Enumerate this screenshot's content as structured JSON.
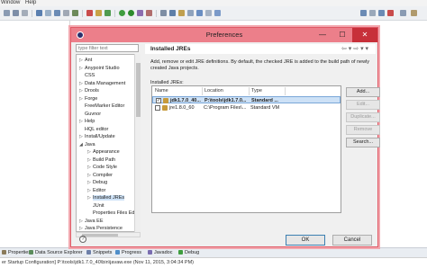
{
  "ide": {
    "menu": [
      "Window",
      "Help"
    ],
    "bottom_tabs": [
      "Properties",
      "Data Source Explorer",
      "Snippets",
      "Progress",
      "Javadoc",
      "Debug"
    ],
    "status_text": "er Startup Configuration] P:\\tools\\jdk1.7.0_40\\bin\\javaw.exe (Nov 11, 2015, 3:04:34 PM)"
  },
  "dialog": {
    "title": "Preferences",
    "window_controls": {
      "minimize": "—",
      "maximize": "☐",
      "close": "✕"
    },
    "filter_placeholder": "type filter text",
    "tree": [
      {
        "label": "Ant",
        "level": 0,
        "expandable": true
      },
      {
        "label": "Anypoint Studio",
        "level": 0,
        "expandable": true
      },
      {
        "label": "CSS",
        "level": 0,
        "expandable": false
      },
      {
        "label": "Data Management",
        "level": 0,
        "expandable": true
      },
      {
        "label": "Drools",
        "level": 0,
        "expandable": true
      },
      {
        "label": "Forge",
        "level": 0,
        "expandable": true
      },
      {
        "label": "FreeMarker Editor",
        "level": 0,
        "expandable": false
      },
      {
        "label": "Guvnor",
        "level": 0,
        "expandable": false
      },
      {
        "label": "Help",
        "level": 0,
        "expandable": true
      },
      {
        "label": "HQL editor",
        "level": 0,
        "expandable": false
      },
      {
        "label": "Install/Update",
        "level": 0,
        "expandable": true
      },
      {
        "label": "Java",
        "level": 0,
        "expandable": true,
        "expanded": true
      },
      {
        "label": "Appearance",
        "level": 1,
        "expandable": true
      },
      {
        "label": "Build Path",
        "level": 1,
        "expandable": true
      },
      {
        "label": "Code Style",
        "level": 1,
        "expandable": true
      },
      {
        "label": "Compiler",
        "level": 1,
        "expandable": true
      },
      {
        "label": "Debug",
        "level": 1,
        "expandable": true
      },
      {
        "label": "Editor",
        "level": 1,
        "expandable": true
      },
      {
        "label": "Installed JREs",
        "level": 1,
        "expandable": true,
        "selected": true
      },
      {
        "label": "JUnit",
        "level": 1,
        "expandable": false
      },
      {
        "label": "Properties Files Editor",
        "level": 1,
        "expandable": false
      },
      {
        "label": "Java EE",
        "level": 0,
        "expandable": true
      },
      {
        "label": "Java Persistence",
        "level": 0,
        "expandable": true
      }
    ],
    "pane": {
      "title": "Installed JREs",
      "nav_arrows": "⇦ ▾ ⇨ ▾ ▾",
      "description": "Add, remove or edit JRE definitions. By default, the checked JRE is added to the build path of newly created Java projects.",
      "list_label": "Installed JREs:",
      "columns": [
        "Name",
        "Location",
        "Type"
      ],
      "rows": [
        {
          "checked": true,
          "name": "jdk1.7.0_40...",
          "location": "P:\\tools\\jdk1.7.0...",
          "type": "Standard ...",
          "selected": true
        },
        {
          "checked": false,
          "name": "jre1.8.0_60",
          "location": "C:\\Program Files\\...",
          "type": "Standard VM",
          "selected": false
        }
      ],
      "buttons": {
        "add": "Add...",
        "edit": "Edit...",
        "duplicate": "Duplicate...",
        "remove": "Remove",
        "search": "Search..."
      }
    },
    "help_symbol": "?",
    "ok": "OK",
    "cancel": "Cancel"
  },
  "colors": {
    "titlebar": "#ec7f8a",
    "close_button": "#c7303a",
    "selection": "#cde1f6"
  }
}
